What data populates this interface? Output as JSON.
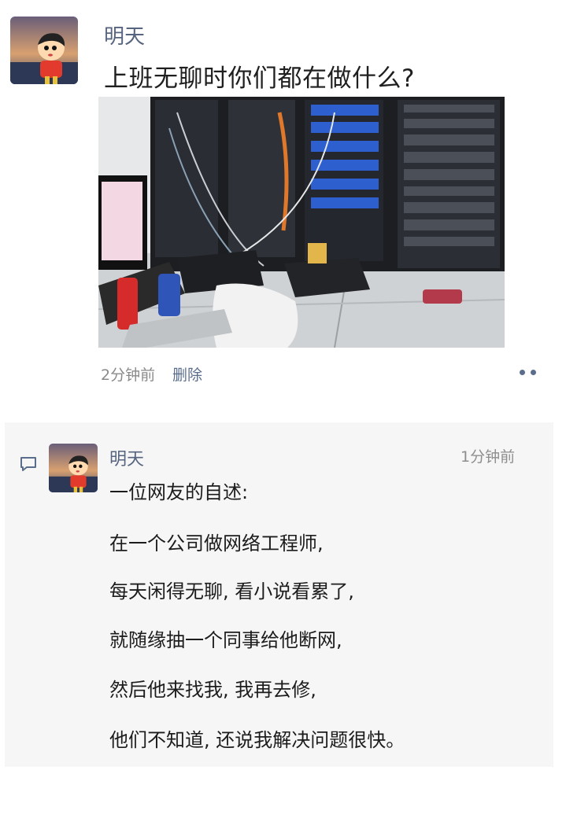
{
  "post": {
    "author": "明天",
    "text": "上班无聊时你们都在做什么?",
    "time": "2分钟前",
    "delete_label": "删除"
  },
  "comment": {
    "author": "明天",
    "time": "1分钟前",
    "lines": [
      "一位网友的自述:",
      "在一个公司做网络工程师,",
      "每天闲得无聊, 看小说看累了,",
      "就随缘抽一个同事给他断网,",
      "然后他来找我, 我再去修,",
      "他们不知道, 还说我解决问题很快。"
    ]
  },
  "icons": {
    "more": "more-dots-icon",
    "comment": "comment-bubble-icon"
  },
  "colors": {
    "author_name": "#56647f",
    "link": "#5a6d8c",
    "comment_bg": "#f6f6f6"
  }
}
